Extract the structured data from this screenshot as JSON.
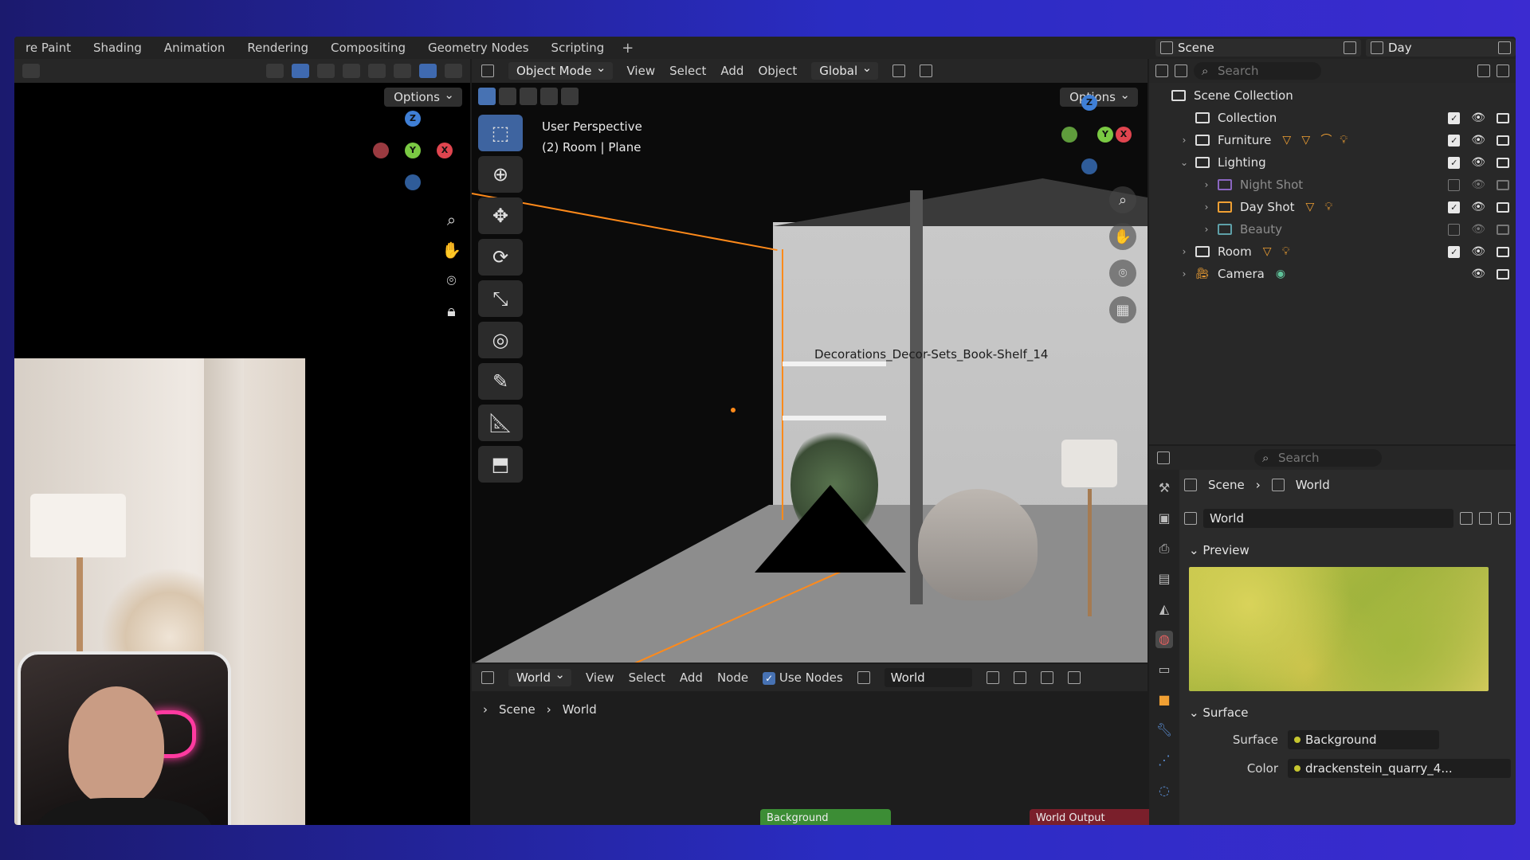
{
  "workspace_tabs": [
    "re Paint",
    "Shading",
    "Animation",
    "Rendering",
    "Compositing",
    "Geometry Nodes",
    "Scripting"
  ],
  "workspace_add": "+",
  "scene_selector": "Scene",
  "view_layer_selector": "Day",
  "left_panel": {
    "options_label": "Options"
  },
  "gizmo_axes": {
    "x": "X",
    "y": "Y",
    "z": "Z"
  },
  "viewport": {
    "mode": "Object Mode",
    "menus": [
      "View",
      "Select",
      "Add",
      "Object"
    ],
    "transform_orientation": "Global",
    "options_label": "Options",
    "info_line1": "User Perspective",
    "info_line2": "(2) Room | Plane",
    "object_label": "Decorations_Decor-Sets_Book-Shelf_14"
  },
  "node_editor": {
    "type": "World",
    "menus": [
      "View",
      "Select",
      "Add",
      "Node"
    ],
    "use_nodes_label": "Use Nodes",
    "world_name": "World",
    "breadcrumb": [
      "Scene",
      "World"
    ],
    "nodes": [
      "Background",
      "World Output"
    ]
  },
  "outliner": {
    "search_placeholder": "Search",
    "rows": [
      {
        "label": "Scene Collection",
        "checked": null,
        "dim": false
      },
      {
        "label": "Collection",
        "checked": true,
        "dim": false
      },
      {
        "label": "Furniture",
        "checked": true,
        "dim": false
      },
      {
        "label": "Lighting",
        "checked": true,
        "dim": false
      },
      {
        "label": "Night Shot",
        "checked": false,
        "dim": true
      },
      {
        "label": "Day Shot",
        "checked": true,
        "dim": false
      },
      {
        "label": "Beauty",
        "checked": false,
        "dim": true
      },
      {
        "label": "Room",
        "checked": true,
        "dim": false
      },
      {
        "label": "Camera",
        "checked": null,
        "dim": false
      }
    ]
  },
  "properties": {
    "search_placeholder": "Search",
    "breadcrumb": [
      "Scene",
      "World"
    ],
    "world_name": "World",
    "preview_title": "Preview",
    "surface_title": "Surface",
    "surface_label": "Surface",
    "surface_value": "Background",
    "color_label": "Color",
    "color_value": "drackenstein_quarry_4..."
  }
}
